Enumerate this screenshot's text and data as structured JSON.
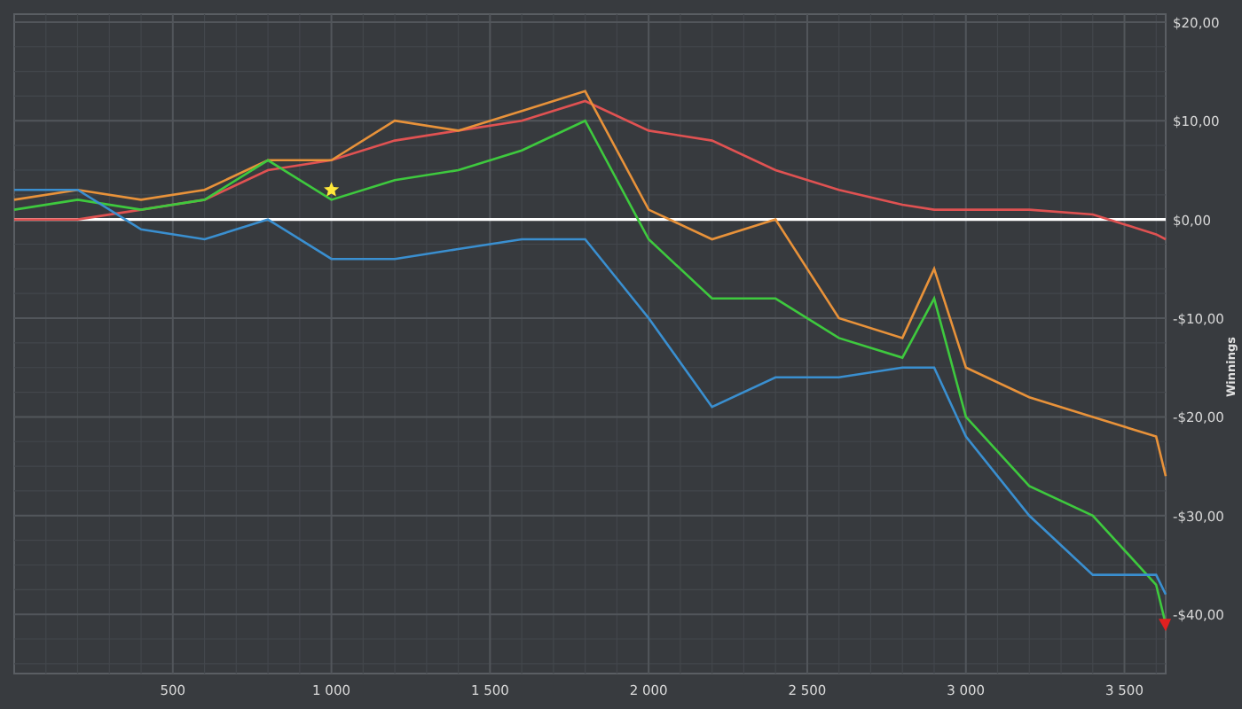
{
  "chart_data": {
    "type": "line",
    "ylabel": "Winnings",
    "x": [
      0,
      200,
      400,
      600,
      800,
      1000,
      1200,
      1400,
      1600,
      1800,
      2000,
      2200,
      2400,
      2600,
      2800,
      2900,
      3000,
      3200,
      3400,
      3600,
      3630
    ],
    "series": [
      {
        "color": "#e05252",
        "values": [
          0,
          0,
          1,
          2,
          5,
          6,
          8,
          9,
          10,
          12,
          9,
          8,
          5,
          3,
          1.5,
          1,
          1,
          1,
          0.5,
          -1.5,
          -2
        ]
      },
      {
        "color": "#e8923a",
        "values": [
          2,
          3,
          2,
          3,
          6,
          6,
          10,
          9,
          11,
          13,
          1,
          -2,
          0,
          -10,
          -12,
          -5,
          -15,
          -18,
          -20,
          -22,
          -26
        ]
      },
      {
        "color": "#3ec93e",
        "values": [
          1,
          2,
          1,
          2,
          6,
          2,
          4,
          5,
          7,
          10,
          -2,
          -8,
          -8,
          -12,
          -14,
          -8,
          -20,
          -27,
          -30,
          -37,
          -41
        ]
      },
      {
        "color": "#3a8fd0",
        "values": [
          3,
          3,
          -1,
          -2,
          0,
          -4,
          -4,
          -3,
          -2,
          -2,
          -10,
          -19,
          -16,
          -16,
          -15,
          -15,
          -22,
          -30,
          -36,
          -36,
          -38
        ]
      }
    ],
    "grid": true,
    "xlim": [
      0,
      3630
    ],
    "ylim": [
      -46,
      20.8
    ],
    "xticks": [
      {
        "value": 500,
        "label": "500"
      },
      {
        "value": 1000,
        "label": "1 000"
      },
      {
        "value": 1500,
        "label": "1 500"
      },
      {
        "value": 2000,
        "label": "2 000"
      },
      {
        "value": 2500,
        "label": "2 500"
      },
      {
        "value": 3000,
        "label": "3 000"
      },
      {
        "value": 3500,
        "label": "3 500"
      }
    ],
    "yticks": [
      {
        "value": 20,
        "label": "$20,00"
      },
      {
        "value": 10,
        "label": "$10,00"
      },
      {
        "value": 0,
        "label": "$0,00"
      },
      {
        "value": -10,
        "label": "-$10,00"
      },
      {
        "value": -20,
        "label": "-$20,00"
      },
      {
        "value": -30,
        "label": "-$30,00"
      },
      {
        "value": -40,
        "label": "-$40,00"
      }
    ]
  }
}
